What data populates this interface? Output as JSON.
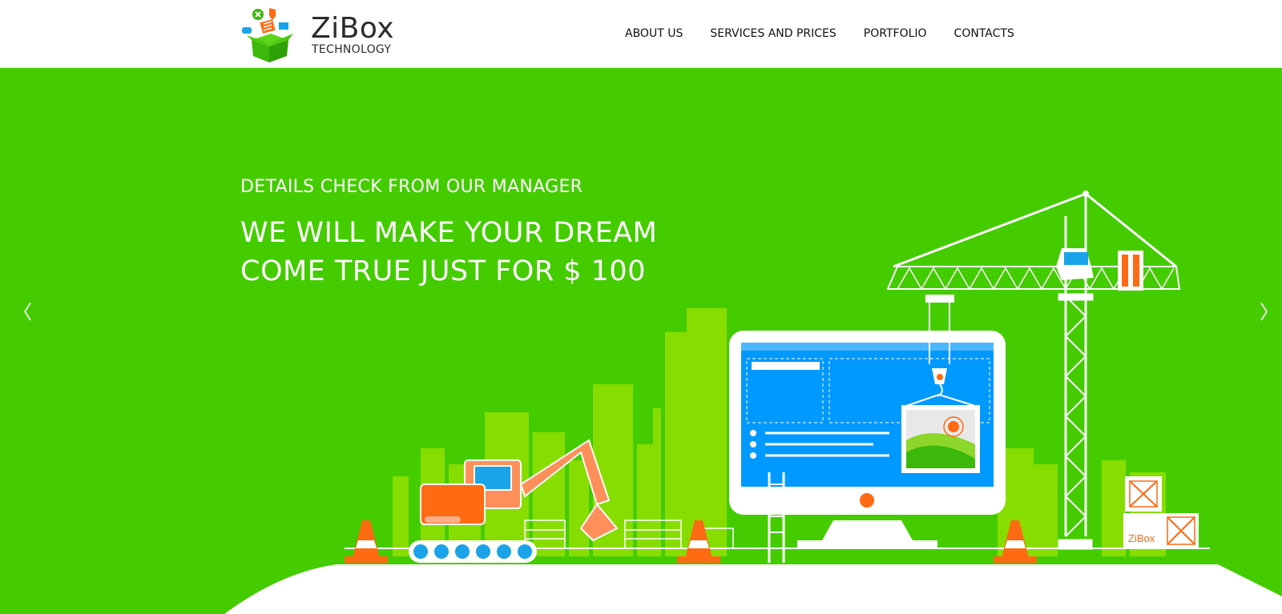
{
  "brand": {
    "name": "ZiBox",
    "tagline": "TECHNOLOGY"
  },
  "nav": {
    "items": [
      "ABOUT US",
      "SERVICES AND PRICES",
      "PORTFOLIO",
      "CONTACTS"
    ]
  },
  "hero": {
    "subtitle": "DETAILS CHECK FROM OUR MANAGER",
    "headline_line1": "WE WILL MAKE YOUR DREAM",
    "headline_line2": "COME TRUE JUST FOR $ 100",
    "prev_arrow": "〈",
    "next_arrow": "〉",
    "box_label": "ZiBox"
  },
  "colors": {
    "hero_bg": "#44cc00",
    "city": "#88dd00",
    "accent_orange": "#ff6a13",
    "screen_blue": "#0099ff",
    "text_dark": "#2b2b2b"
  },
  "icons": [
    "zibox-logo-icon",
    "excavator-icon",
    "crane-icon",
    "monitor-icon",
    "traffic-cone-icon"
  ]
}
